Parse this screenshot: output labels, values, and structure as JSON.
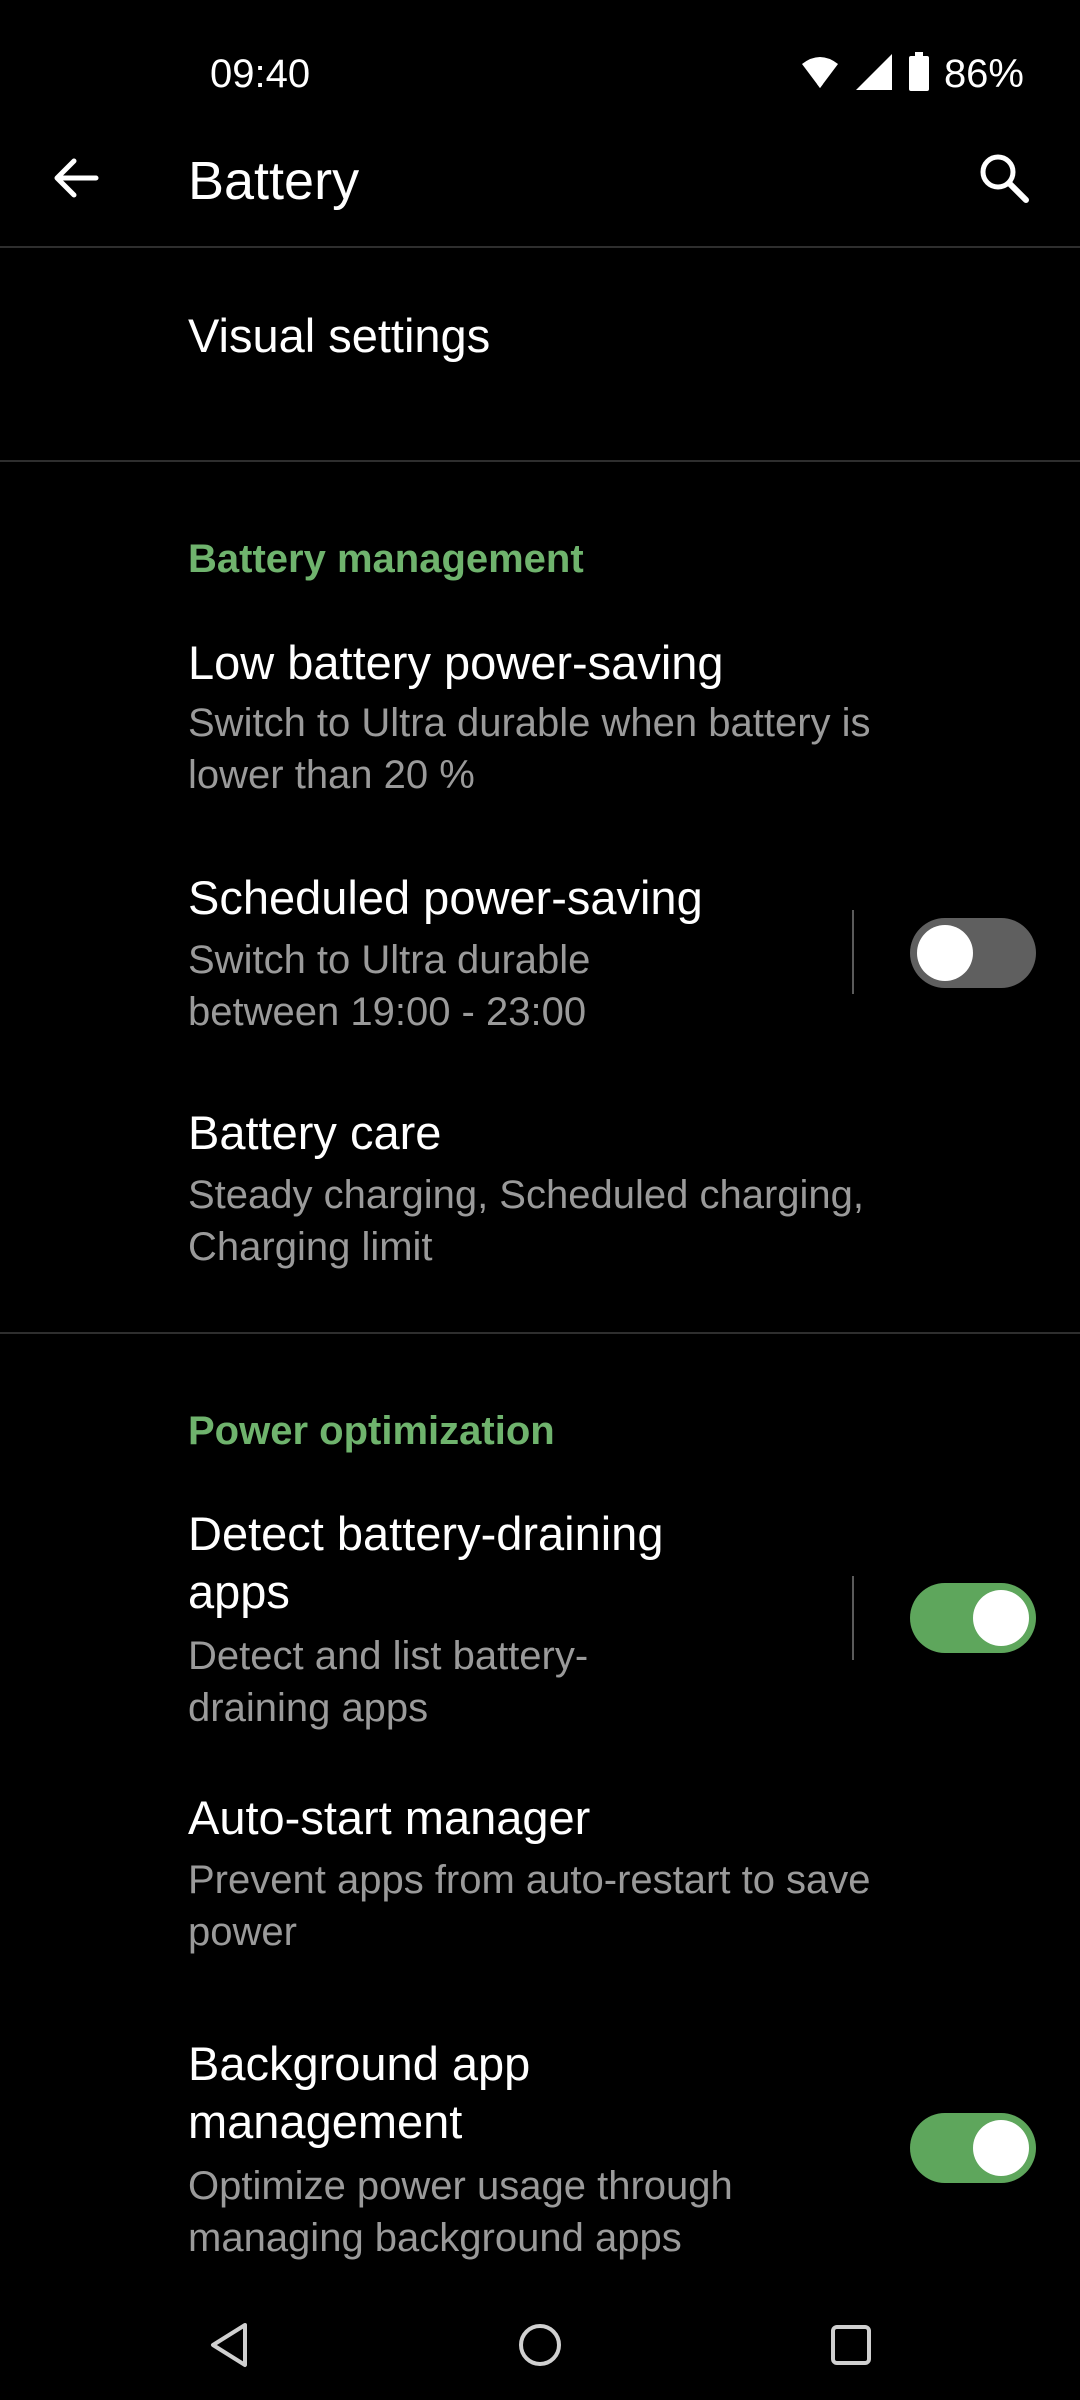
{
  "status_bar": {
    "time": "09:40",
    "battery_percent": "86%",
    "icons": [
      "wifi-icon",
      "cell-signal-icon",
      "battery-icon"
    ]
  },
  "app_bar": {
    "title": "Battery",
    "back_icon": "back-arrow-icon",
    "search_icon": "search-icon"
  },
  "visual_settings": {
    "title": "Visual settings"
  },
  "battery_management": {
    "header": "Battery management",
    "items": [
      {
        "title": "Low battery power-saving",
        "subtitle": "Switch to Ultra durable when battery is lower than 20 %"
      },
      {
        "title": "Scheduled power-saving",
        "subtitle": "Switch to Ultra durable between 19:00 - 23:00",
        "toggle": false
      },
      {
        "title": "Battery care",
        "subtitle": "Steady charging, Scheduled charging, Charging limit"
      }
    ]
  },
  "power_optimization": {
    "header": "Power optimization",
    "items": [
      {
        "title": "Detect battery-draining apps",
        "subtitle": "Detect and list battery-draining apps",
        "toggle": true
      },
      {
        "title": "Auto-start manager",
        "subtitle": "Prevent apps from auto-restart to save power"
      },
      {
        "title": "Background app management",
        "subtitle": "Optimize power usage through managing background apps",
        "toggle": true
      }
    ]
  },
  "colors": {
    "accent": "#6fb36d",
    "toggle_on": "#5ea65c",
    "toggle_off": "#5f5f5f",
    "background": "#000000"
  },
  "nav_bar": {
    "icons": [
      "nav-back-icon",
      "nav-home-icon",
      "nav-recents-icon"
    ]
  }
}
